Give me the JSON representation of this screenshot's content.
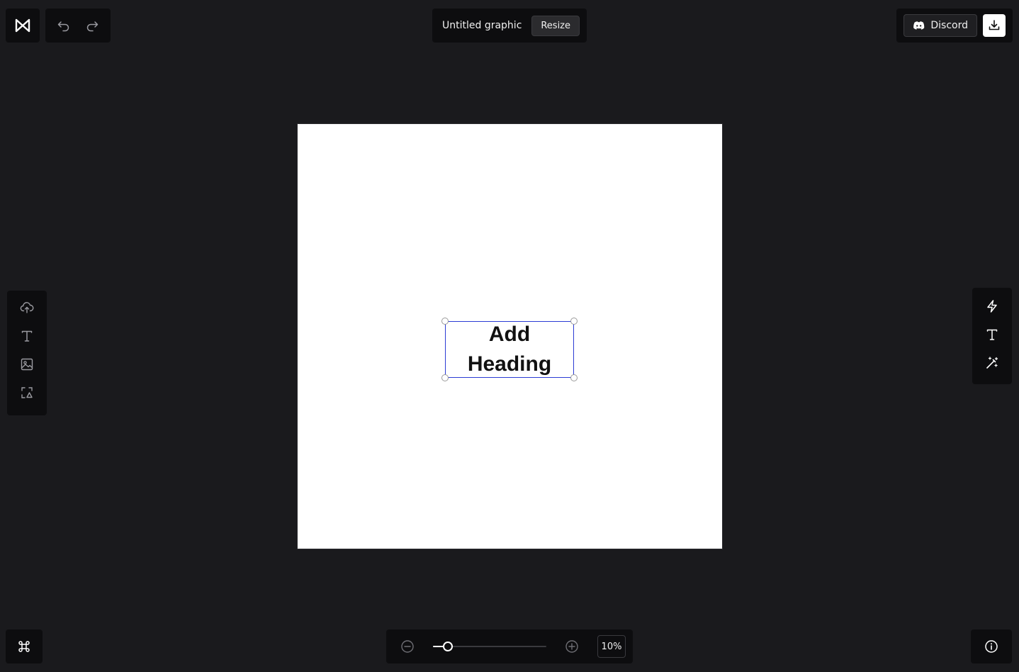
{
  "app": {
    "logo_icon": "bowtie-logo-icon"
  },
  "history": {
    "undo_icon": "undo-icon",
    "redo_icon": "redo-icon"
  },
  "header": {
    "doc_title": "Untitled graphic",
    "resize_label": "Resize"
  },
  "top_right": {
    "discord_label": "Discord",
    "discord_icon": "discord-icon",
    "download_icon": "download-icon"
  },
  "left_toolbar": {
    "items": [
      {
        "name": "upload",
        "icon": "cloud-upload-icon"
      },
      {
        "name": "text",
        "icon": "text-icon"
      },
      {
        "name": "image",
        "icon": "image-icon"
      },
      {
        "name": "shapes",
        "icon": "shapes-icon"
      }
    ]
  },
  "right_toolbar": {
    "items": [
      {
        "name": "quick-actions",
        "icon": "lightning-icon"
      },
      {
        "name": "text",
        "icon": "text-icon"
      },
      {
        "name": "magic",
        "icon": "magic-wand-icon"
      }
    ]
  },
  "canvas": {
    "background": "#ffffff",
    "heading_line1": "Add",
    "heading_line2": "Heading",
    "selection_color": "#2b3bd4"
  },
  "bottom": {
    "command_icon": "command-icon",
    "zoom_out_icon": "zoom-out-icon",
    "zoom_in_icon": "zoom-in-icon",
    "zoom_value": "10%",
    "zoom_level_fraction": 0.13,
    "info_icon": "info-icon"
  },
  "colors": {
    "app_bg": "#1a1a1d",
    "panel_bg": "#0d0d0f",
    "accent": "#ffffff"
  }
}
